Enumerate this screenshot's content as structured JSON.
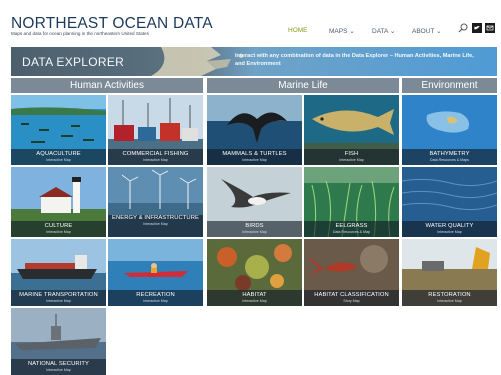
{
  "header": {
    "logo_title": "NORTHEAST OCEAN DATA",
    "logo_subtitle": "Maps and data for ocean planning in the northeastern United States",
    "nav": [
      {
        "label": "HOME",
        "active": true
      },
      {
        "label": "MAPS ⌄"
      },
      {
        "label": "DATA ⌄"
      },
      {
        "label": "ABOUT ⌄"
      }
    ],
    "icons": [
      "search-icon",
      "twitter-icon",
      "email-icon"
    ]
  },
  "banner": {
    "title": "DATA EXPLORER",
    "text": "Interact with any combination of data in the Data Explorer – Human Activities, Marine Life, and Environment"
  },
  "sections": {
    "human": "Human Activities",
    "marine": "Marine Life",
    "environment": "Environment"
  },
  "tiles": {
    "aquaculture": {
      "title": "AQUACULTURE",
      "sub": "Interactive Map"
    },
    "commercial_fishing": {
      "title": "COMMERCIAL FISHING",
      "sub": "Interactive Map"
    },
    "mammals": {
      "title": "MAMMALS & TURTLES",
      "sub": "Interactive Map"
    },
    "fish": {
      "title": "FISH",
      "sub": "Interactive Map"
    },
    "bathymetry": {
      "title": "BATHYMETRY",
      "sub": "Data Resources & Maps"
    },
    "culture": {
      "title": "CULTURE",
      "sub": "Interactive Map"
    },
    "energy": {
      "title": "ENERGY & INFRASTRUCTURE",
      "sub": "Interactive Map"
    },
    "birds": {
      "title": "BIRDS",
      "sub": "Interactive Map"
    },
    "eelgrass": {
      "title": "EELGRASS",
      "sub": "Data Resources & Map"
    },
    "water_quality": {
      "title": "WATER QUALITY",
      "sub": "Interactive Map"
    },
    "marine_transportation": {
      "title": "MARINE TRANSPORTATION",
      "sub": "Interactive Map"
    },
    "recreation": {
      "title": "RECREATION",
      "sub": "Interactive Map"
    },
    "habitat": {
      "title": "HABITAT",
      "sub": "Interactive Map"
    },
    "habitat_classification": {
      "title": "HABITAT CLASSIFICATION",
      "sub": "Story Map"
    },
    "restoration": {
      "title": "RESTORATION",
      "sub": "Interactive Map"
    },
    "national_security": {
      "title": "NATIONAL SECURITY",
      "sub": "Interactive Map"
    }
  },
  "colors": {
    "section_header": "#7b8a96",
    "banner_dark": "#4d6473",
    "banner_light": "#5aa2d4",
    "logo": "#1c3a5c",
    "nav_active": "#8a9a1a"
  }
}
